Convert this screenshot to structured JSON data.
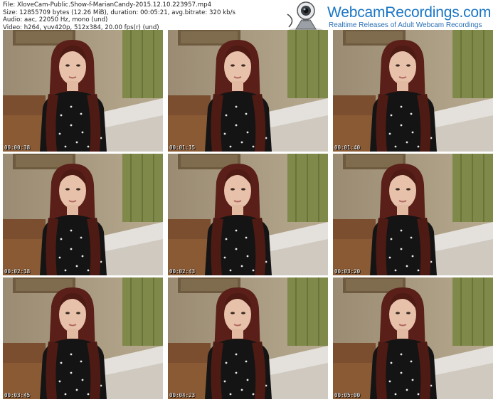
{
  "header": {
    "line1": "File: XloveCam-Public.Show-f-MarianCandy-2015.12.10.223957.mp4",
    "line2": "Size: 12855709 bytes (12.26 MiB), duration: 00:05:21, avg.bitrate: 320 kb/s",
    "line3": "Audio: aac, 22050 Hz, mono (und)",
    "line4": "Video: h264, yuv420p, 512x384, 20.00 fps(r) (und)"
  },
  "logo": {
    "title": "WebcamRecordings.com",
    "tagline": "Realtime Releases of Adult Webcam Recordings",
    "icon": "webcam-icon"
  },
  "thumbnails": [
    {
      "time": "00:00:38"
    },
    {
      "time": "00:01:15"
    },
    {
      "time": "00:01:40"
    },
    {
      "time": "00:02:18"
    },
    {
      "time": "00:02:43"
    },
    {
      "time": "00:03:20"
    },
    {
      "time": "00:03:45"
    },
    {
      "time": "00:04:23"
    },
    {
      "time": "00:05:00"
    }
  ]
}
